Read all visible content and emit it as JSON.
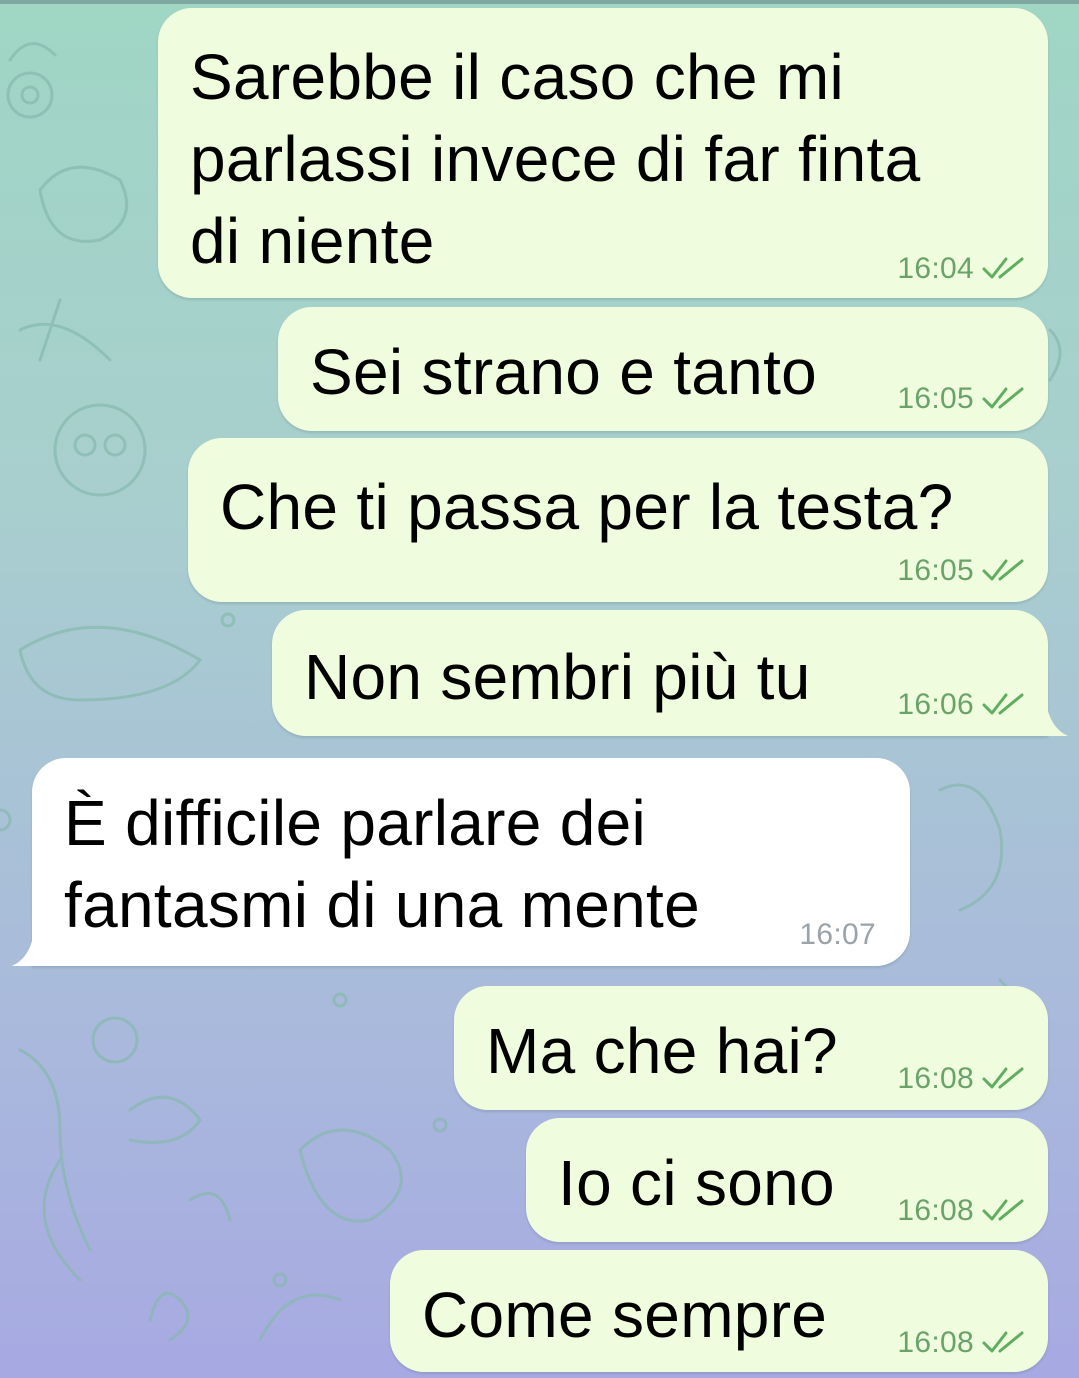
{
  "colors": {
    "outgoing_bubble": "#effdde",
    "incoming_bubble": "#ffffff",
    "time_outgoing": "#6aa36a",
    "time_incoming": "#9aa3aa",
    "ticks": "#5fae5f"
  },
  "messages": [
    {
      "direction": "outgoing",
      "lines": [
        "Sarebbe il caso che mi",
        "parlassi invece di far finta",
        "di niente"
      ],
      "time": "16:04",
      "status": "read-double-check"
    },
    {
      "direction": "outgoing",
      "lines": [
        "Sei strano e tanto"
      ],
      "time": "16:05",
      "status": "read-double-check"
    },
    {
      "direction": "outgoing",
      "lines": [
        "Che ti passa per la testa?"
      ],
      "time": "16:05",
      "status": "read-double-check"
    },
    {
      "direction": "outgoing",
      "lines": [
        "Non sembri più tu"
      ],
      "time": "16:06",
      "status": "read-double-check"
    },
    {
      "direction": "incoming",
      "lines": [
        "È difficile parlare dei",
        "fantasmi di una mente"
      ],
      "time": "16:07"
    },
    {
      "direction": "outgoing",
      "lines": [
        "Ma che hai?"
      ],
      "time": "16:08",
      "status": "read-double-check"
    },
    {
      "direction": "outgoing",
      "lines": [
        "Io ci sono"
      ],
      "time": "16:08",
      "status": "read-double-check"
    },
    {
      "direction": "outgoing",
      "lines": [
        "Come sempre"
      ],
      "time": "16:08",
      "status": "read-double-check"
    }
  ]
}
